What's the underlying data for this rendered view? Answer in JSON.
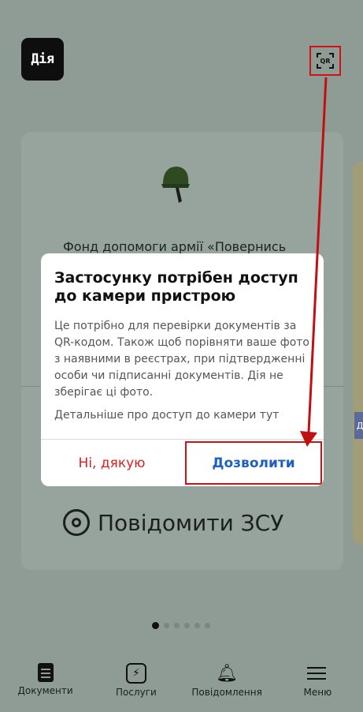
{
  "app": {
    "logo_text": "Дія"
  },
  "header": {
    "qr_label": "QR"
  },
  "card": {
    "title": "Фонд допомоги армії «Повернись",
    "action_label": "Повідомити ЗСУ"
  },
  "side_card": {
    "tag": "Д"
  },
  "pagination": {
    "count": 6,
    "active": 0
  },
  "dialog": {
    "title": "Застосунку потрібен доступ до камери пристрою",
    "body": "Це потрібно для перевірки документів за QR-кодом. Також щоб порівняти ваше фото з наявними в реєстрах, при підтвердженні особи чи підписанні документів. Дія не зберігає ці фото.",
    "link_text": "Детальніше про доступ до камери тут",
    "deny_label": "Ні, дякую",
    "allow_label": "Дозволити"
  },
  "nav": {
    "items": [
      {
        "label": "Документи",
        "icon": "document-icon"
      },
      {
        "label": "Послуги",
        "icon": "lightning-icon"
      },
      {
        "label": "Повідомлення",
        "icon": "bell-icon"
      },
      {
        "label": "Меню",
        "icon": "menu-icon"
      }
    ]
  },
  "colors": {
    "highlight": "#d01212",
    "deny": "#e02020",
    "allow": "#1f5fbf",
    "backdrop": "#8f9b95"
  }
}
